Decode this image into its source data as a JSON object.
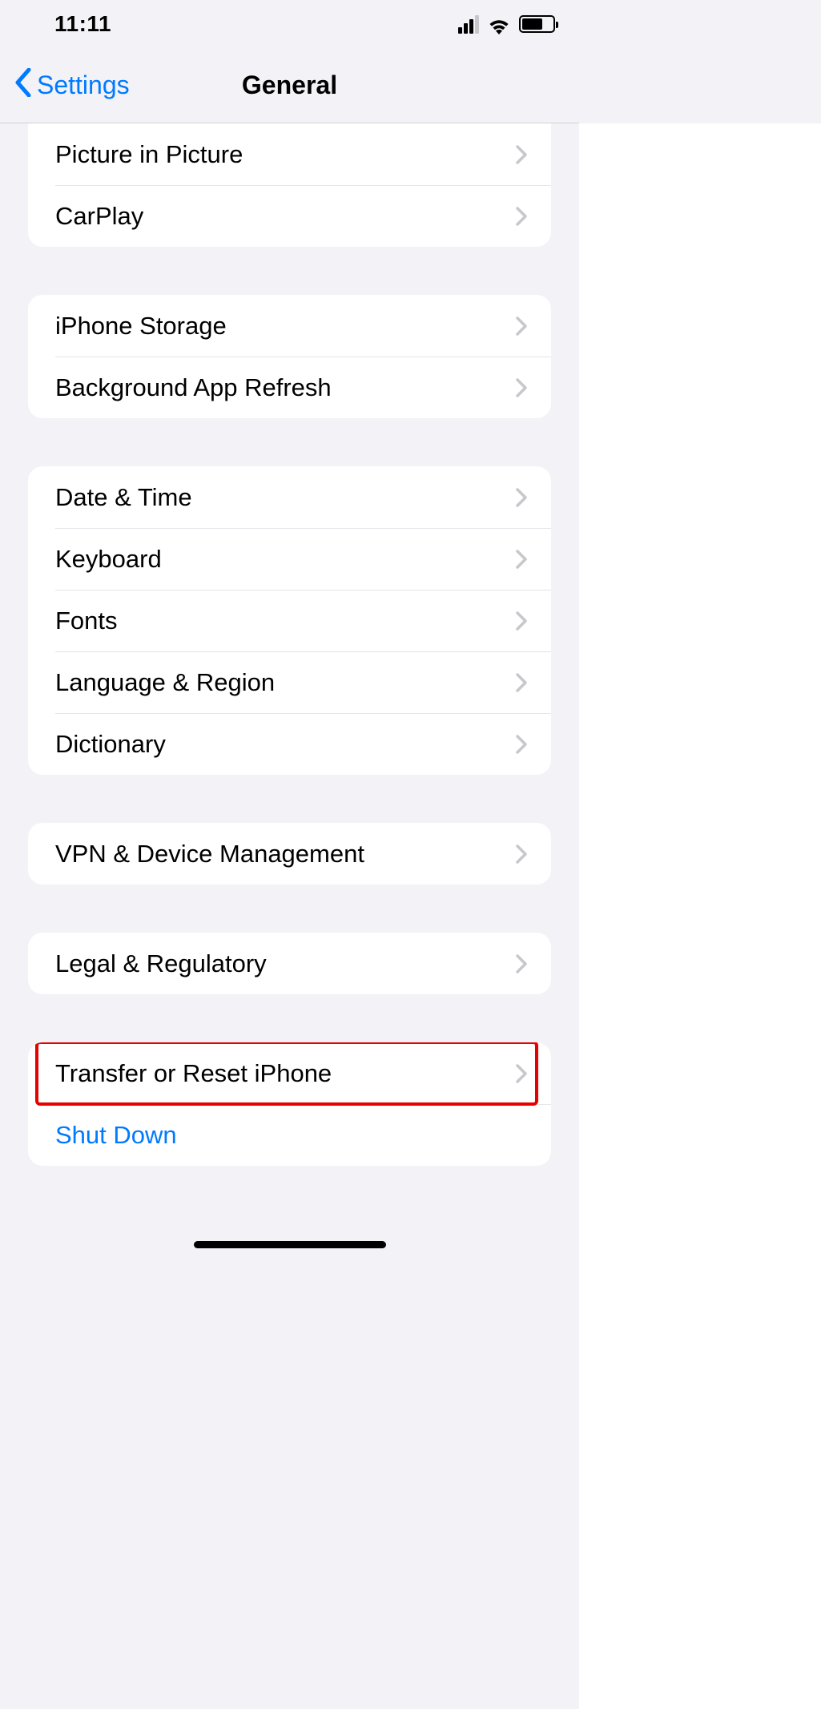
{
  "statusbar": {
    "time": "11:11"
  },
  "nav": {
    "back_label": "Settings",
    "title": "General"
  },
  "groups": [
    {
      "id": "g1",
      "items": [
        {
          "id": "pip",
          "label": "Picture in Picture",
          "chevron": true
        },
        {
          "id": "carplay",
          "label": "CarPlay",
          "chevron": true
        }
      ]
    },
    {
      "id": "g2",
      "items": [
        {
          "id": "storage",
          "label": "iPhone Storage",
          "chevron": true
        },
        {
          "id": "bg-refresh",
          "label": "Background App Refresh",
          "chevron": true
        }
      ]
    },
    {
      "id": "g3",
      "items": [
        {
          "id": "datetime",
          "label": "Date & Time",
          "chevron": true
        },
        {
          "id": "keyboard",
          "label": "Keyboard",
          "chevron": true
        },
        {
          "id": "fonts",
          "label": "Fonts",
          "chevron": true
        },
        {
          "id": "lang",
          "label": "Language & Region",
          "chevron": true
        },
        {
          "id": "dict",
          "label": "Dictionary",
          "chevron": true
        }
      ]
    },
    {
      "id": "g4",
      "items": [
        {
          "id": "vpn",
          "label": "VPN & Device Management",
          "chevron": true
        }
      ]
    },
    {
      "id": "g5",
      "items": [
        {
          "id": "legal",
          "label": "Legal & Regulatory",
          "chevron": true
        }
      ]
    },
    {
      "id": "g6",
      "items": [
        {
          "id": "reset",
          "label": "Transfer or Reset iPhone",
          "chevron": true,
          "highlight": true
        },
        {
          "id": "shutdown",
          "label": "Shut Down",
          "chevron": false,
          "blue": true
        }
      ]
    }
  ]
}
